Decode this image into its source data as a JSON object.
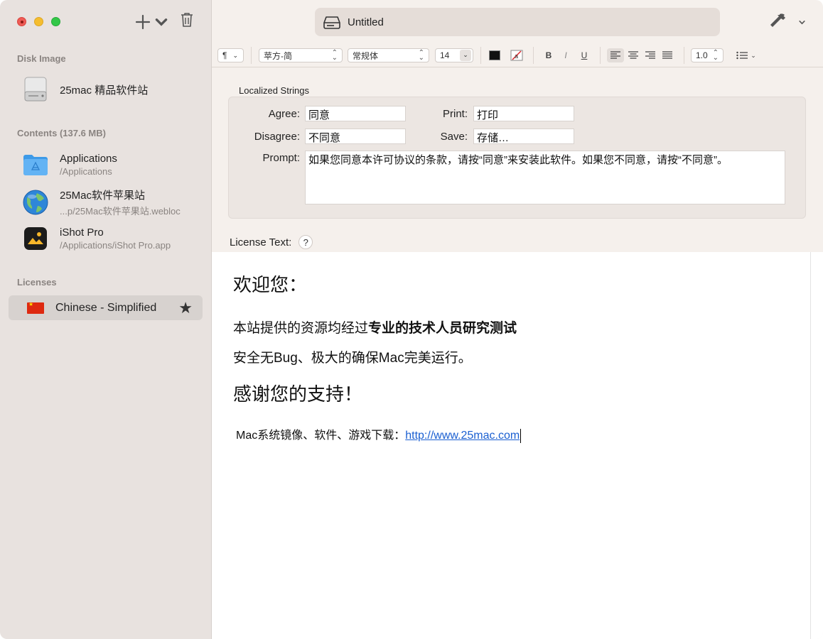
{
  "window": {
    "title": "Untitled"
  },
  "sidebar": {
    "sections": {
      "disk_image": "Disk Image",
      "contents": "Contents (137.6 MB)",
      "licenses": "Licenses"
    },
    "disk": {
      "name": "25mac 精品软件站"
    },
    "contents": [
      {
        "name": "Applications",
        "path": "/Applications",
        "icon": "folder-icon"
      },
      {
        "name": "25Mac软件苹果站",
        "path": "...p/25Mac软件苹果站.webloc",
        "icon": "globe-icon"
      },
      {
        "name": "iShot Pro",
        "path": "/Applications/iShot Pro.app",
        "icon": "app-icon"
      }
    ],
    "licenses": [
      {
        "name": "Chinese - Simplified",
        "flag": "china-flag-icon",
        "default": true
      }
    ]
  },
  "toolbar": {
    "paragraph": "¶",
    "font_family": "苹方-简",
    "font_style": "常规体",
    "font_size": "14",
    "bold": "B",
    "italic": "I",
    "underline": "U",
    "line_spacing": "1.0"
  },
  "localized": {
    "label": "Localized Strings",
    "agree_label": "Agree:",
    "agree_value": "同意",
    "disagree_label": "Disagree:",
    "disagree_value": "不同意",
    "print_label": "Print:",
    "print_value": "打印",
    "save_label": "Save:",
    "save_value": "存储…",
    "prompt_label": "Prompt:",
    "prompt_value": "如果您同意本许可协议的条款，请按“同意”来安装此软件。如果您不同意，请按“不同意”。"
  },
  "license_text": {
    "label": "License Text:",
    "help": "?",
    "heading1": "欢迎您：",
    "line1_normal": "本站提供的资源均经过",
    "line1_bold": "专业的技术人员研究测试",
    "line2": "安全无Bug、极大的确保Mac完美运行。",
    "heading2": "感谢您的支持！",
    "line3_prefix": "Mac系统镜像、软件、游戏下载：",
    "line3_link": "http://www.25mac.com"
  },
  "colors": {
    "sidebar_bg": "#e8e2df",
    "main_bg": "#f5f0ec",
    "link": "#1a5fd1",
    "selected_row": "#d7d2cf"
  }
}
